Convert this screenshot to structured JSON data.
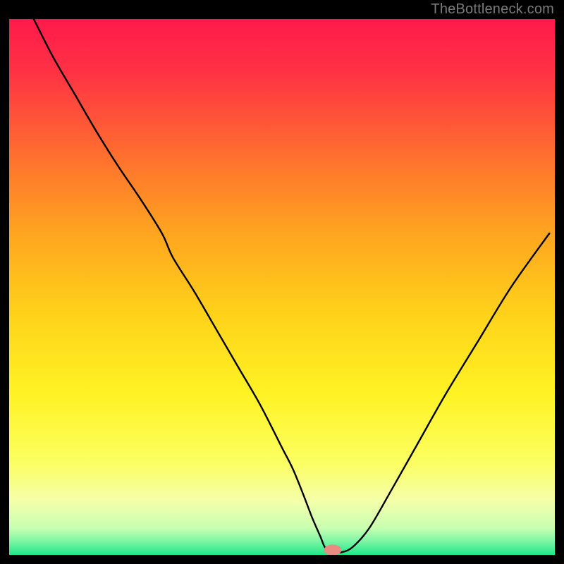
{
  "watermark": "TheBottleneck.com",
  "chart_data": {
    "type": "line",
    "title": "",
    "xlabel": "",
    "ylabel": "",
    "xlim": [
      0,
      100
    ],
    "ylim": [
      0,
      100
    ],
    "grid": false,
    "legend": false,
    "gradient_stops": [
      {
        "offset": 0.0,
        "color": "#ff1a4b"
      },
      {
        "offset": 0.1,
        "color": "#ff3244"
      },
      {
        "offset": 0.25,
        "color": "#ff6d2f"
      },
      {
        "offset": 0.4,
        "color": "#ffa51f"
      },
      {
        "offset": 0.55,
        "color": "#ffd21a"
      },
      {
        "offset": 0.7,
        "color": "#fff324"
      },
      {
        "offset": 0.83,
        "color": "#fbff63"
      },
      {
        "offset": 0.9,
        "color": "#f4ffab"
      },
      {
        "offset": 0.95,
        "color": "#c8ffb0"
      },
      {
        "offset": 0.975,
        "color": "#7bf5a5"
      },
      {
        "offset": 1.0,
        "color": "#1ee888"
      }
    ],
    "series": [
      {
        "name": "bottleneck-curve",
        "color": "#000000",
        "x": [
          4.5,
          8,
          12,
          16,
          20,
          24,
          28,
          30,
          34,
          38,
          42,
          46,
          50,
          52,
          54,
          55.5,
          57,
          58,
          59.5,
          61,
          63,
          66,
          70,
          75,
          80,
          86,
          92,
          99
        ],
        "y": [
          100,
          93,
          86,
          79,
          72.5,
          66.5,
          60,
          55.5,
          49,
          42,
          35,
          28,
          20,
          16,
          11,
          7,
          3.5,
          1.2,
          0.5,
          0.5,
          1.5,
          5,
          12,
          21,
          30,
          40,
          50,
          60
        ]
      }
    ],
    "marker": {
      "name": "optimal-point",
      "x": 59.3,
      "y": 0.9,
      "rx": 1.6,
      "ry": 1.0,
      "color": "#e98b80"
    }
  }
}
